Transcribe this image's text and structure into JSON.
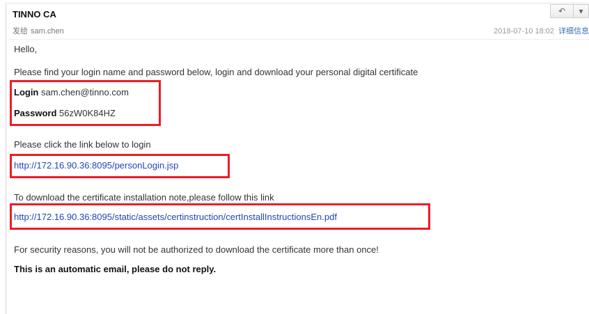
{
  "email": {
    "sender": "TINNO CA",
    "to_prefix": "发给",
    "to_name": "sam.chen",
    "date": "2018-07-10 18:02",
    "details_link": "详细信息",
    "toolbar": {
      "reply_icon": "reply-arrow-icon",
      "more_icon": "dropdown-arrow-icon"
    }
  },
  "body": {
    "greeting": "Hello,",
    "intro": "Please find your login name and password below, login and download your personal digital certificate",
    "login_label": "Login",
    "login_value": "sam.chen@tinno.com",
    "password_label": "Password",
    "password_value": "56zW0K84HZ",
    "click_link_text": "Please click the link below to login",
    "login_url": "http://172.16.90.36:8095/personLogin.jsp",
    "download_note": "To download the certificate installation note,please follow this link",
    "instructions_url": "http://172.16.90.36:8095/static/assets/certinstruction/certInstallInstructionsEn.pdf",
    "security_note": "For security reasons, you will not be authorized to download the certificate more than once!",
    "auto_note": "This is an automatic email, please do not reply."
  },
  "colors": {
    "highlight_box": "#ee1c25",
    "link": "#2345b8"
  }
}
